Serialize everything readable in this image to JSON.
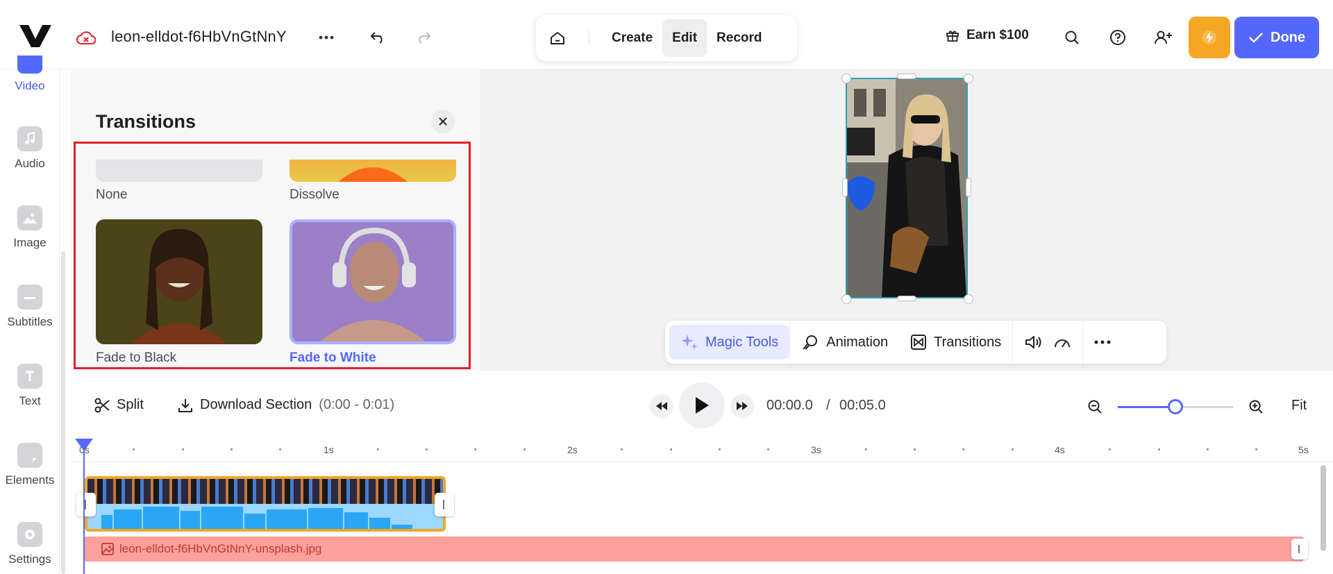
{
  "header": {
    "filename": "leon-elldot-f6HbVnGtNnY",
    "modes": [
      {
        "label": "Create",
        "active": false
      },
      {
        "label": "Edit",
        "active": true
      },
      {
        "label": "Record",
        "active": false
      }
    ],
    "earn_label": "Earn $100",
    "done_label": "Done",
    "icons": [
      "logo",
      "cloud-error-icon",
      "more-icon",
      "undo-icon",
      "redo-icon",
      "home-icon",
      "gift-icon",
      "search-icon",
      "help-icon",
      "add-user-icon",
      "flash-icon",
      "check-icon"
    ]
  },
  "sidebar": {
    "items": [
      {
        "label": "Video",
        "icon": "video-icon",
        "active": true
      },
      {
        "label": "Audio",
        "icon": "music-icon",
        "active": false
      },
      {
        "label": "Image",
        "icon": "image-icon",
        "active": false
      },
      {
        "label": "Subtitles",
        "icon": "subtitles-icon",
        "active": false
      },
      {
        "label": "Text",
        "icon": "text-icon",
        "active": false
      },
      {
        "label": "Elements",
        "icon": "elements-icon",
        "active": false
      },
      {
        "label": "Settings",
        "icon": "settings-icon",
        "active": false
      }
    ]
  },
  "panel": {
    "title": "Transitions",
    "transitions": [
      {
        "label": "None",
        "selected": false
      },
      {
        "label": "Dissolve",
        "selected": false
      },
      {
        "label": "Fade to Black",
        "selected": false
      },
      {
        "label": "Fade to White",
        "selected": true
      }
    ]
  },
  "toolbar": {
    "magic_label": "Magic Tools",
    "animation_label": "Animation",
    "transitions_label": "Transitions"
  },
  "timeline": {
    "split_label": "Split",
    "download_label": "Download Section",
    "range_label": "(0:00 - 0:01)",
    "current_time": "00:00.0",
    "separator": "/",
    "total_time": "00:05.0",
    "fit_label": "Fit",
    "zoom_level": 0.5,
    "ruler_labels": [
      "0s",
      "1s",
      "2s",
      "3s",
      "4s",
      "5s"
    ],
    "image_track_label": "leon-elldot-f6HbVnGtNnY-unsplash.jpg"
  },
  "colors": {
    "accent": "#5468ff",
    "flash": "#f5a623",
    "highlight": "#e0202a",
    "image_track": "#fca19c"
  }
}
